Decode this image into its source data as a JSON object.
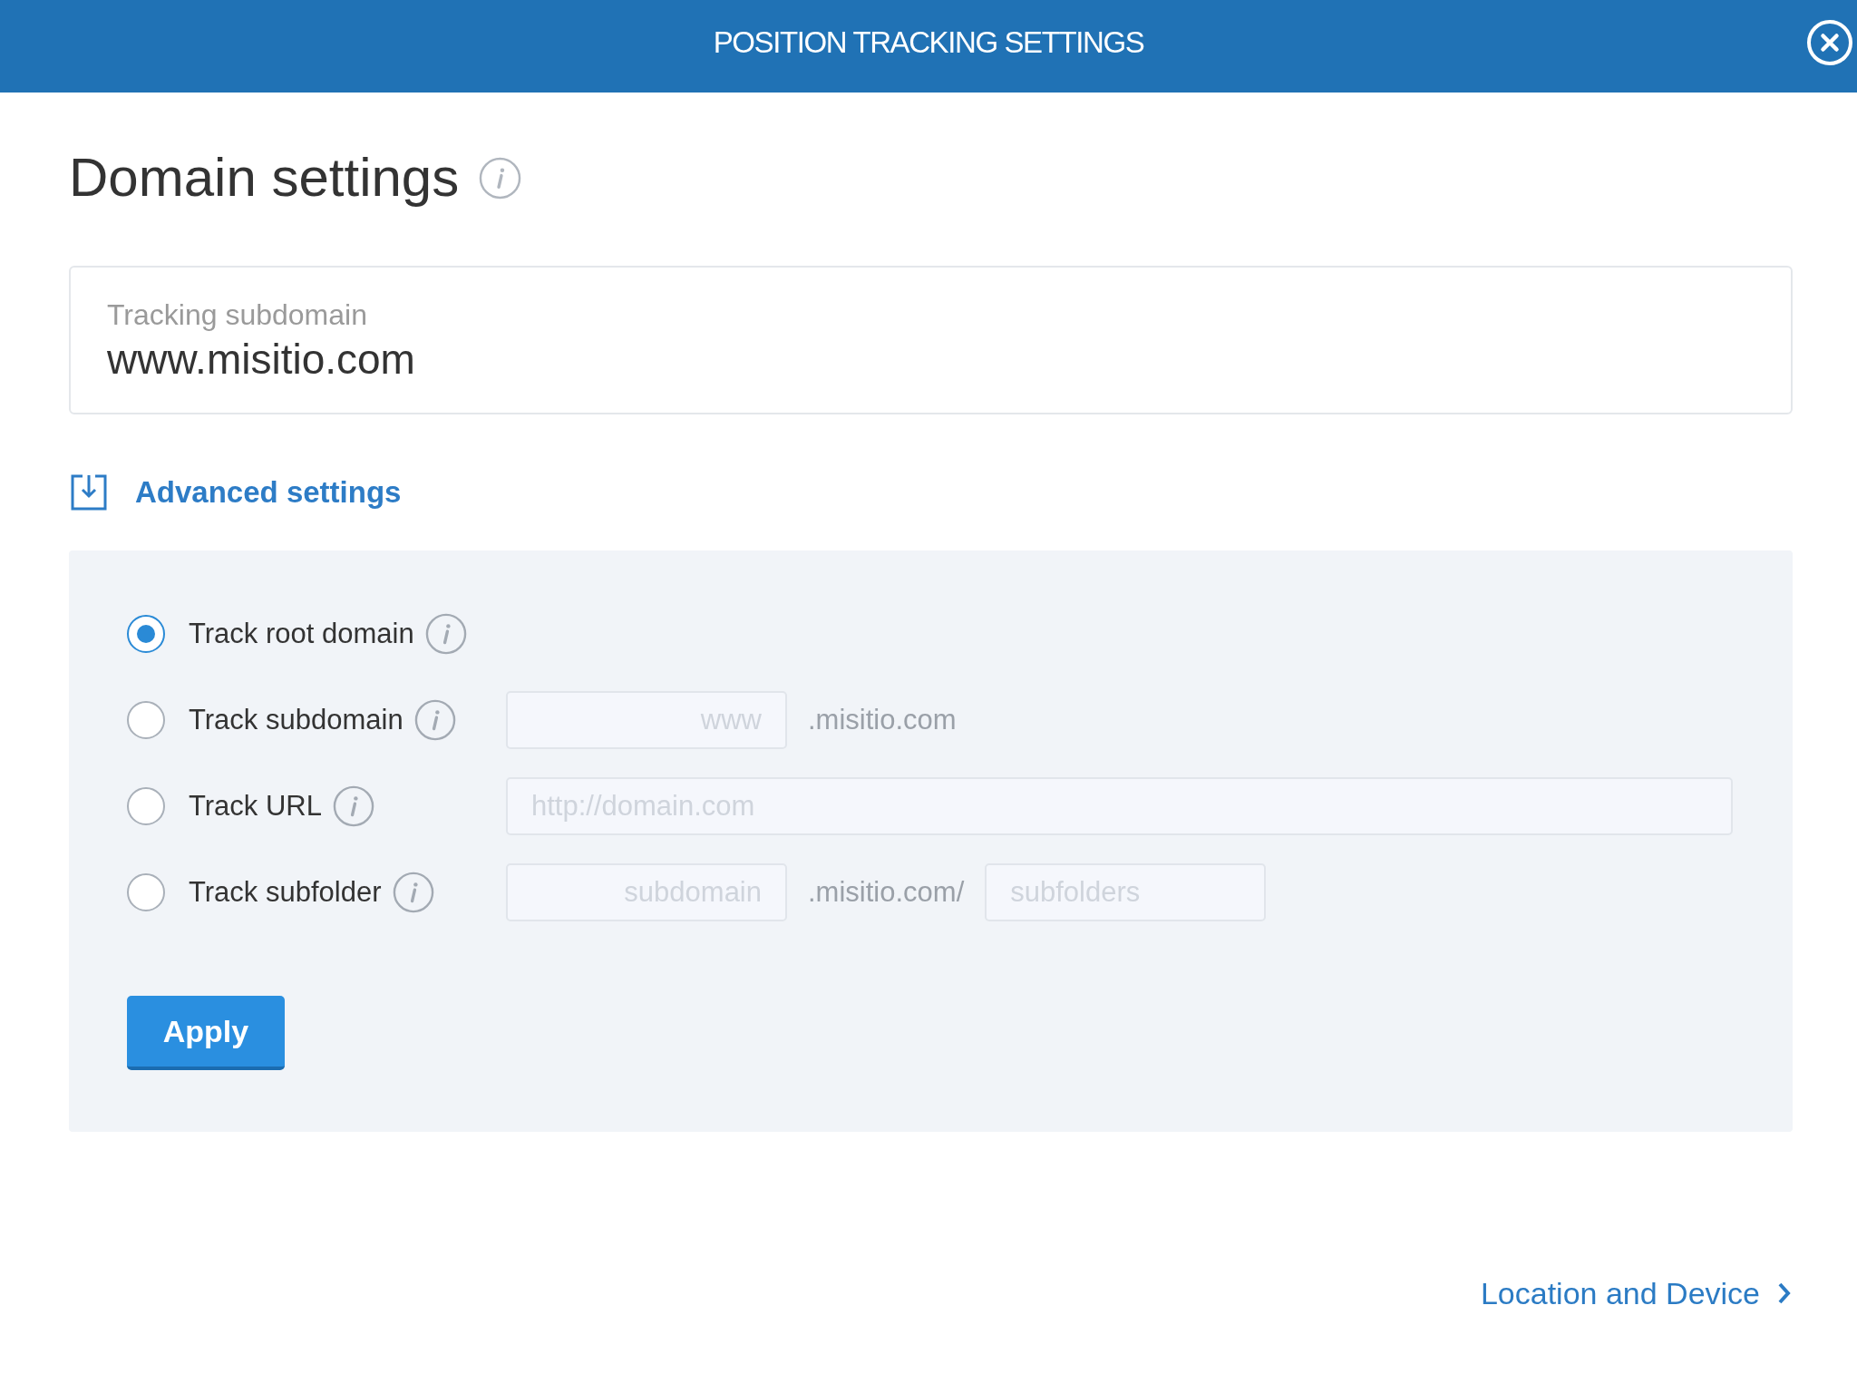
{
  "dialog": {
    "title": "POSITION TRACKING SETTINGS"
  },
  "domain_settings": {
    "title": "Domain settings",
    "tracking_field": {
      "label": "Tracking subdomain",
      "value": "www.misitio.com"
    },
    "advanced": {
      "label": "Advanced settings",
      "expanded": true,
      "options": [
        {
          "label": "Track root domain",
          "selected": true
        },
        {
          "label": "Track subdomain",
          "selected": false,
          "parts": [
            {
              "kind": "input",
              "placeholder": "www"
            },
            {
              "kind": "text",
              "text": ".misitio.com"
            }
          ]
        },
        {
          "label": "Track URL",
          "selected": false,
          "parts": [
            {
              "kind": "input",
              "placeholder": "http://domain.com"
            }
          ]
        },
        {
          "label": "Track subfolder",
          "selected": false,
          "parts": [
            {
              "kind": "input",
              "placeholder": "subdomain"
            },
            {
              "kind": "text",
              "text": ".misitio.com/"
            },
            {
              "kind": "input",
              "placeholder": "subfolders"
            }
          ]
        }
      ],
      "apply_button": "Apply"
    }
  },
  "next_link": "Location and Device"
}
